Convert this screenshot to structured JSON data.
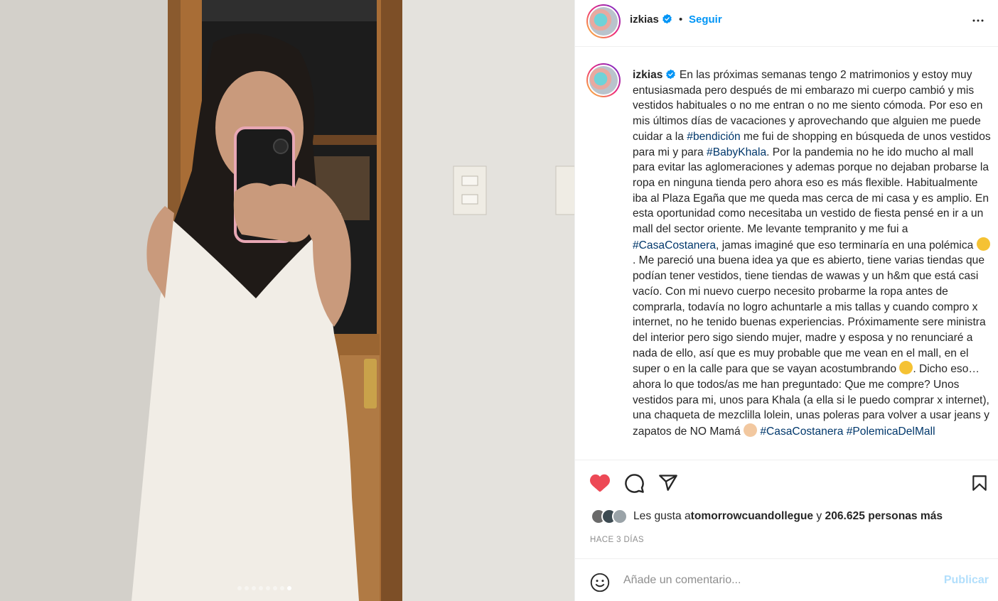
{
  "post": {
    "username": "izkias",
    "separator": "•",
    "follow_label": "Seguir",
    "more_icon": "more-horizontal-icon",
    "verified_icon": "verified-badge-icon",
    "carousel": {
      "total": 8,
      "active_index": 7
    }
  },
  "caption": {
    "username": "izkias",
    "segments": [
      {
        "type": "text",
        "text": " En las próximas semanas tengo 2 matrimonios y estoy muy entusiasmada pero después de mi embarazo mi cuerpo cambió y mis vestidos habituales o no me entran o no me siento cómoda. Por eso en mis últimos días de vacaciones y aprovechando que alguien me puede cuidar a la "
      },
      {
        "type": "hashtag",
        "text": "#bendición"
      },
      {
        "type": "text",
        "text": " me fui de shopping en búsqueda de unos vestidos para mi y para "
      },
      {
        "type": "hashtag",
        "text": "#BabyKhala"
      },
      {
        "type": "text",
        "text": ". Por la pandemia no he ido mucho al mall para evitar las aglomeraciones y ademas porque no dejaban probarse la ropa en ninguna tienda pero ahora eso es más flexible. Habitualmente iba al Plaza Egaña que me queda mas cerca de mi casa y es amplio. En esta oportunidad como necesitaba un vestido de fiesta pensé en ir a un mall del sector oriente. Me levante tempranito y me fui a "
      },
      {
        "type": "hashtag",
        "text": "#CasaCostanera"
      },
      {
        "type": "text",
        "text": ", jamas imaginé que eso terminaría en una polémica "
      },
      {
        "type": "emoji",
        "name": "pleading-face-emoji"
      },
      {
        "type": "text",
        "text": ". Me pareció una buena idea ya que es abierto, tiene varias tiendas que podían tener vestidos, tiene tiendas de wawas y un h&m que está casi vacío. Con mi nuevo cuerpo necesito probarme la ropa antes de comprarla, todavía no logro achuntarle a mis tallas y cuando compro x internet, no he tenido buenas experiencias. Próximamente sere ministra del interior pero sigo siendo mujer, madre y esposa y no renunciaré a nada de ello, así que es muy probable que me vean en el mall, en el super o en la calle para que se vayan acostumbrando "
      },
      {
        "type": "emoji",
        "name": "kissing-wink-emoji"
      },
      {
        "type": "text",
        "text": ". Dicho eso… ahora lo que todos/as me han preguntado: Que me compre? Unos vestidos para mi, unos para Khala (a ella si le puedo comprar x internet), una chaqueta de mezclilla lolein, unas poleras para volver a usar jeans y zapatos de NO Mamá "
      },
      {
        "type": "emoji",
        "name": "mother-emoji"
      },
      {
        "type": "text",
        "text": " "
      },
      {
        "type": "hashtag",
        "text": "#CasaCostanera"
      },
      {
        "type": "text",
        "text": " "
      },
      {
        "type": "hashtag",
        "text": "#PolemicaDelMall"
      }
    ]
  },
  "actions": {
    "like_icon": "heart-filled-icon",
    "like_color": "#ed4956",
    "comment_icon": "comment-icon",
    "share_icon": "share-icon",
    "save_icon": "bookmark-icon"
  },
  "likes": {
    "prefix": "Les gusta a ",
    "user": "tomorrowcuandollegue",
    "connector": " y ",
    "count": "206.625 personas más"
  },
  "timestamp": "HACE 3 DÍAS",
  "comment": {
    "emoji_icon": "smiley-icon",
    "placeholder": "Añade un comentario...",
    "publish_label": "Publicar"
  }
}
